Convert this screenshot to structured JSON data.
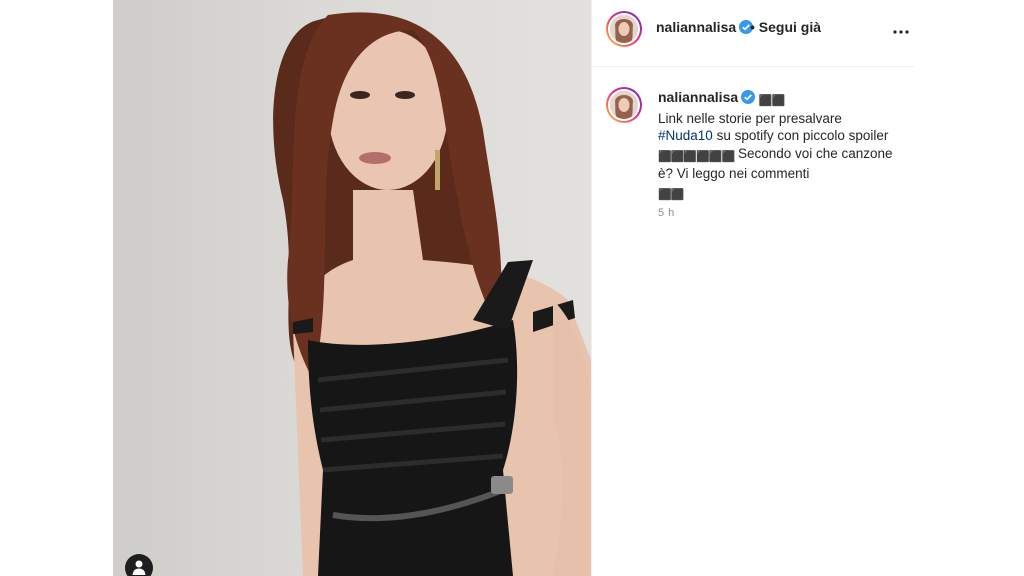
{
  "post": {
    "username": "naliannalisa",
    "follow_label": "• Segui già",
    "caption": {
      "username": "naliannalisa",
      "emoji_1": "⬛⬛",
      "line_1": "Link nelle storie per presalvare",
      "hashtag": "#Nuda10",
      "line_2": " su spotify con piccolo spoiler",
      "emoji_2": "⬛⬛⬛⬛⬛⬛",
      "line_3": " Secondo voi che canzone è? Vi leggo nei commenti",
      "emoji_3": "⬛⬛"
    },
    "timestamp": "5 h"
  },
  "icons": {
    "verified": "verified-badge-icon",
    "more": "more-options-icon",
    "tag": "user-tag-icon"
  },
  "colors": {
    "verified": "#3897f0",
    "hashtag": "#00376b",
    "muted": "#8e8e8e"
  }
}
